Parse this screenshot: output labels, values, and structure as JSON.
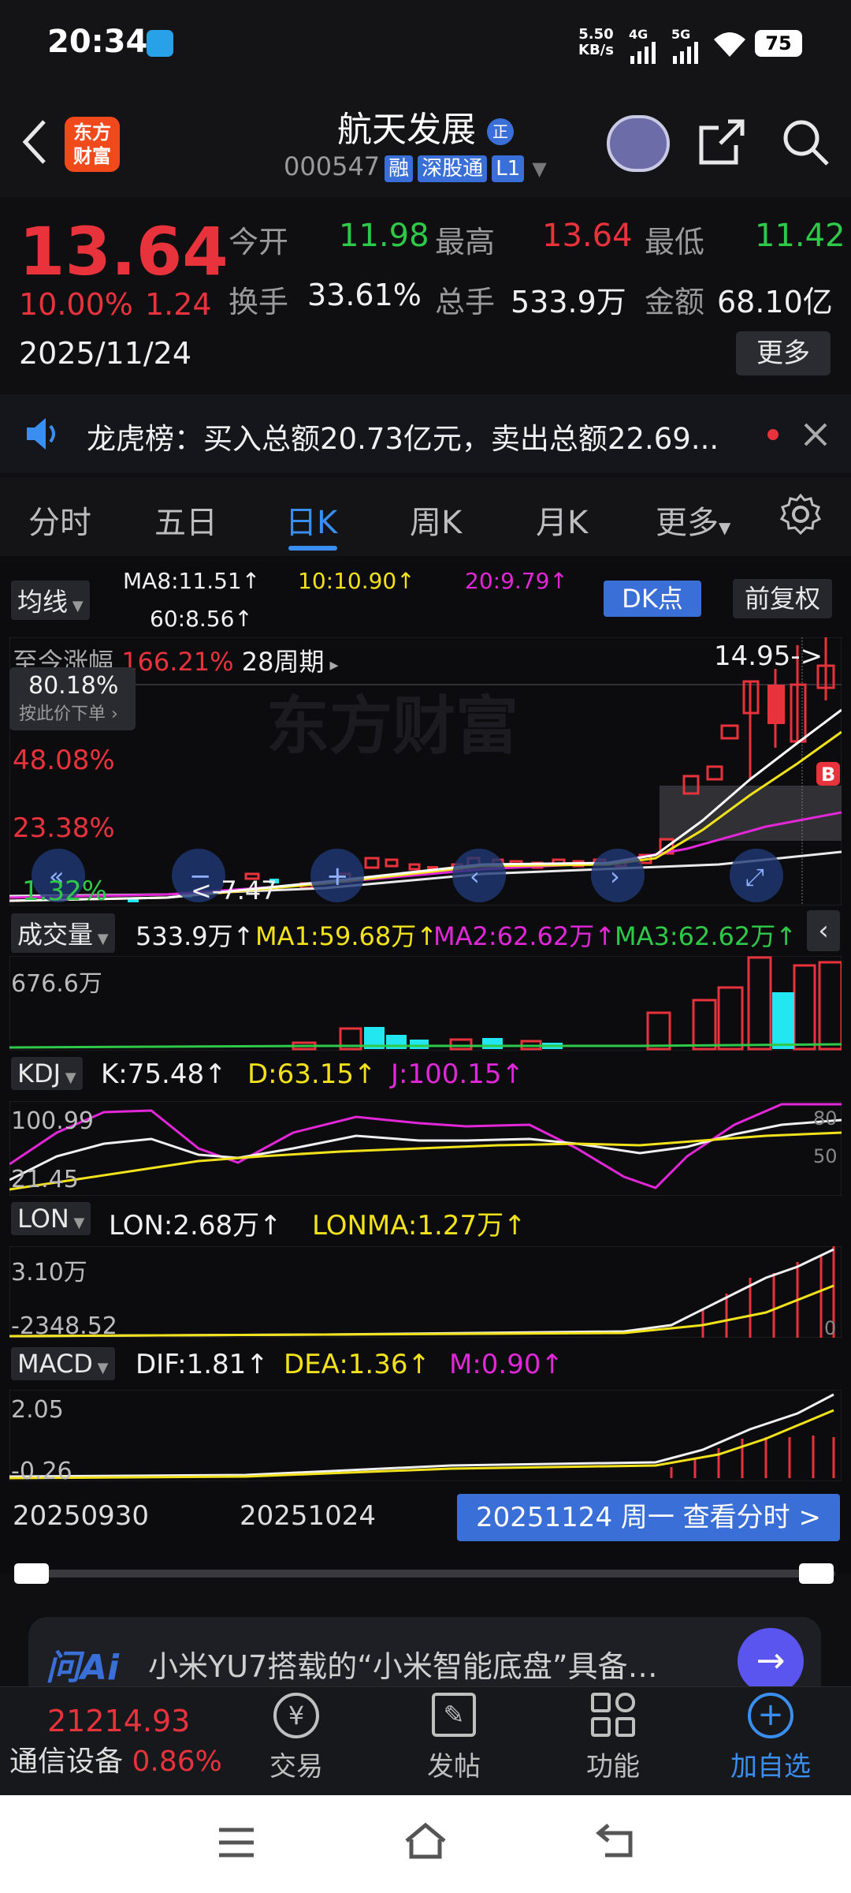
{
  "status": {
    "time": "20:34",
    "speed": "5.50\nKB/s",
    "speed_top": "5.50",
    "speed_bottom": "KB/s",
    "sig1": "4G",
    "sig2": "5G",
    "battery": "75"
  },
  "header": {
    "title": "航天发展",
    "title_badge": "正",
    "code": "000547",
    "tags": [
      "融",
      "深股通",
      "L1"
    ]
  },
  "quote": {
    "price": "13.64",
    "pct": "10.00%",
    "change": "1.24",
    "date": "2025/11/24",
    "open_label": "今开",
    "open": "11.98",
    "high_label": "最高",
    "high": "13.64",
    "low_label": "最低",
    "low": "11.42",
    "turnover_label": "换手",
    "turnover": "33.61%",
    "volume_label": "总手",
    "volume": "533.9万",
    "amount_label": "金额",
    "amount": "68.10亿",
    "more": "更多"
  },
  "news": {
    "text": "龙虎榜：买入总额20.73亿元，卖出总额22.69..."
  },
  "tabs": [
    "分时",
    "五日",
    "日K",
    "周K",
    "月K",
    "更多"
  ],
  "active_tab": "日K",
  "ma": {
    "dropdown": "均线",
    "ma8": "MA8:11.51↑",
    "ma10": "10:10.90↑",
    "ma20": "20:9.79↑",
    "ma60": "60:8.56↑",
    "dk": "DK点",
    "adjust": "前复权"
  },
  "kline": {
    "period_label": "至今涨幅",
    "period_pct": "166.21%",
    "period_count": "28周期",
    "high_mark": "14.95->",
    "low_mark": "<-7.47",
    "pct_levels": [
      "80.18%",
      "48.08%",
      "23.38%",
      "1.32%"
    ],
    "sell_hint": "按此价下单",
    "watermark": "东方财富"
  },
  "volume": {
    "label": "成交量",
    "value": "533.9万↑",
    "ma1": "MA1:59.68万↑",
    "ma2": "MA2:62.62万↑",
    "ma3": "MA3:62.62万↑",
    "axis_top": "676.6万"
  },
  "kdj": {
    "label": "KDJ",
    "k": "K:75.48↑",
    "d": "D:63.15↑",
    "j": "J:100.15↑",
    "axis_top": "100.99",
    "axis_bottom": "21.45",
    "r80": "80",
    "r50": "50"
  },
  "lon": {
    "label": "LON",
    "lon": "LON:2.68万↑",
    "lonma": "LONMA:1.27万↑",
    "axis_top": "3.10万",
    "axis_bottom": "-2348.52",
    "r0": "0"
  },
  "macd": {
    "label": "MACD",
    "dif": "DIF:1.81↑",
    "dea": "DEA:1.36↑",
    "m": "M:0.90↑",
    "axis_top": "2.05",
    "axis_bottom": "-0.26"
  },
  "dates": {
    "d1": "20250930",
    "d2": "20251024",
    "current": "20251124 周一 查看分时 >"
  },
  "ai": {
    "text": "小米YU7搭载的“小米智能底盘”具备…"
  },
  "bottom": {
    "index_value": "21214.93",
    "index_name": "通信设备",
    "index_pct": "0.86%",
    "items": [
      "交易",
      "发帖",
      "功能",
      "加自选"
    ]
  },
  "colors": {
    "up": "#e8323c",
    "down": "#2fc94a",
    "accent": "#3a8ef0",
    "cyan": "#22e6f0"
  }
}
